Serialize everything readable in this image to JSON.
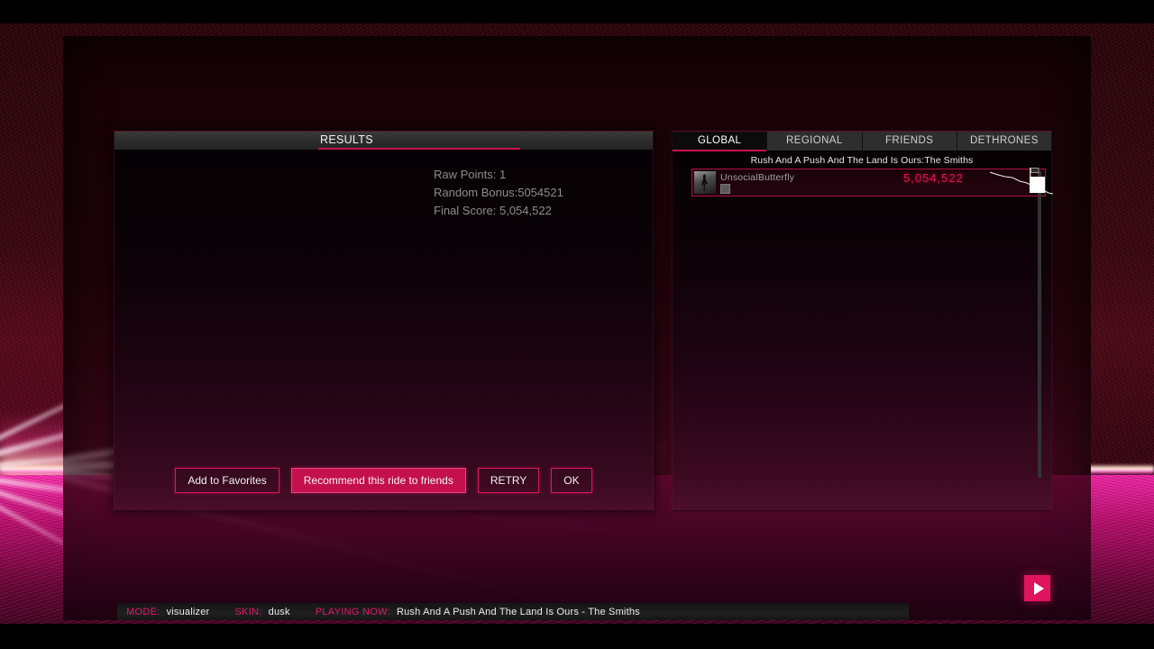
{
  "results_panel": {
    "title": "RESULTS",
    "lines": [
      "Raw Points: 1",
      "Random Bonus:5054521",
      "Final Score: 5,054,522"
    ],
    "buttons": [
      {
        "label": "Add to Favorites",
        "style": "outline"
      },
      {
        "label": "Recommend this ride to friends",
        "style": "filled"
      },
      {
        "label": "RETRY",
        "style": "outline"
      },
      {
        "label": "OK",
        "style": "outline"
      }
    ]
  },
  "leaderboard": {
    "tabs": [
      {
        "label": "GLOBAL",
        "active": true
      },
      {
        "label": "REGIONAL",
        "active": false
      },
      {
        "label": "FRIENDS",
        "active": false
      },
      {
        "label": "DETHRONES",
        "active": false
      }
    ],
    "song_header": "Rush And A Push And The Land Is Ours:The Smiths",
    "entries": [
      {
        "username": "UnsocialButterfly",
        "score": "5,054,522"
      }
    ],
    "icons": {
      "flag": "flag-icon",
      "avatar": "avatar-icon",
      "badge": "badge-icon",
      "sparkline": "score-trend-sparkline"
    }
  },
  "statusbar": {
    "mode_key": "MODE:",
    "mode_value": "visualizer",
    "skin_key": "SKIN:",
    "skin_value": "dusk",
    "now_key": "PLAYING NOW:",
    "now_value": "Rush And A Push And The Land Is Ours - The Smiths"
  },
  "transport": {
    "play_label": "play-icon"
  },
  "colors": {
    "accent": "#c8124f",
    "accent_bright": "#e0145c",
    "score_pink": "#e01550",
    "panel_dark": "#0a0206",
    "tab_inactive": "#2e2e2e",
    "tab_active": "#0b0b0b"
  }
}
